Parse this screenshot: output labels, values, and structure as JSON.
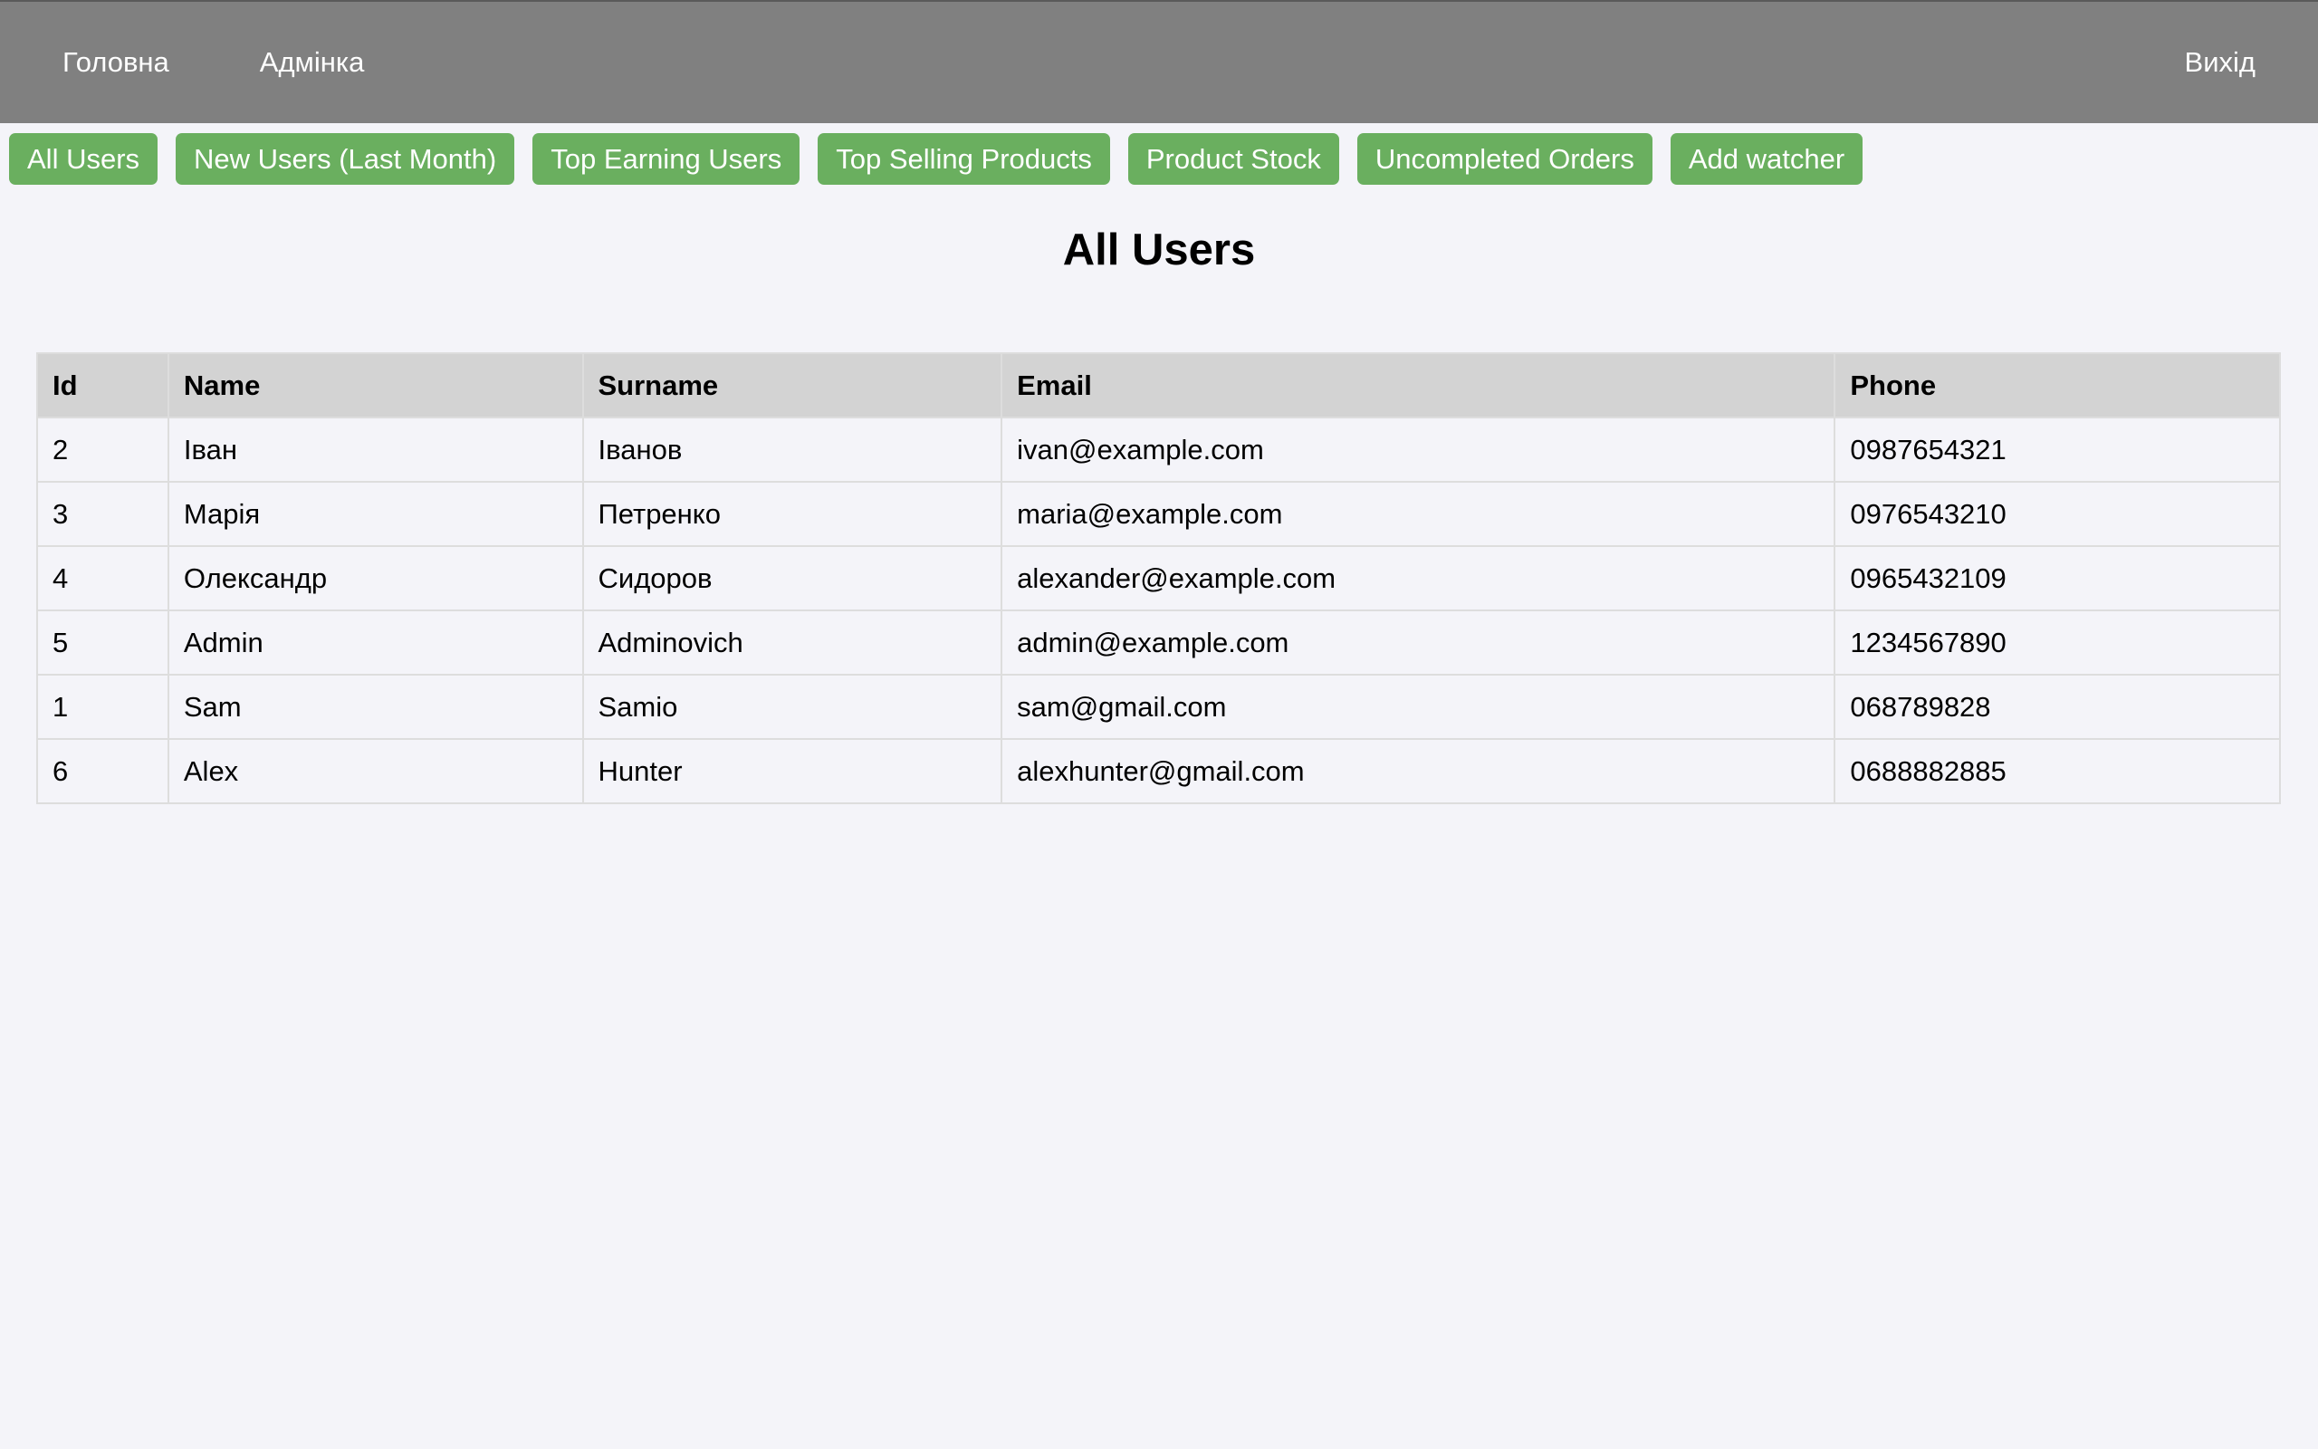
{
  "nav": {
    "home": "Головна",
    "admin": "Адмінка",
    "logout": "Вихід"
  },
  "buttons": [
    "All Users",
    "New Users (Last Month)",
    "Top Earning Users",
    "Top Selling Products",
    "Product Stock",
    "Uncompleted Orders",
    "Add watcher"
  ],
  "page_title": "All Users",
  "table": {
    "headers": [
      "Id",
      "Name",
      "Surname",
      "Email",
      "Phone"
    ],
    "rows": [
      [
        "2",
        "Іван",
        "Іванов",
        "ivan@example.com",
        "0987654321"
      ],
      [
        "3",
        "Марія",
        "Петренко",
        "maria@example.com",
        "0976543210"
      ],
      [
        "4",
        "Олександр",
        "Сидоров",
        "alexander@example.com",
        "0965432109"
      ],
      [
        "5",
        "Admin",
        "Adminovich",
        "admin@example.com",
        "1234567890"
      ],
      [
        "1",
        "Sam",
        "Samio",
        "sam@gmail.com",
        "068789828"
      ],
      [
        "6",
        "Alex",
        "Hunter",
        "alexhunter@gmail.com",
        "0688882885"
      ]
    ]
  },
  "colors": {
    "nav_bg": "#808080",
    "button_bg": "#6aaf5f",
    "page_bg": "#f4f4f9",
    "header_bg": "#d3d3d3"
  }
}
